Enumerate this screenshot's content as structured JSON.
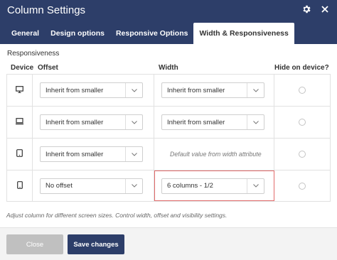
{
  "window": {
    "title": "Column Settings"
  },
  "tabs": [
    {
      "label": "General",
      "active": false
    },
    {
      "label": "Design options",
      "active": false
    },
    {
      "label": "Responsive Options",
      "active": false
    },
    {
      "label": "Width & Responsiveness",
      "active": true
    }
  ],
  "section": {
    "title": "Responsiveness"
  },
  "table": {
    "headers": {
      "device": "Device",
      "offset": "Offset",
      "width": "Width",
      "hide": "Hide on device?"
    },
    "rows": [
      {
        "device_icon": "desktop-icon",
        "offset": "Inherit from smaller",
        "width": "Inherit from smaller",
        "width_note": "",
        "hide": false
      },
      {
        "device_icon": "laptop-icon",
        "offset": "Inherit from smaller",
        "width": "Inherit from smaller",
        "width_note": "",
        "hide": false
      },
      {
        "device_icon": "tablet-icon",
        "offset": "Inherit from smaller",
        "width": "",
        "width_note": "Default value from width attribute",
        "hide": false
      },
      {
        "device_icon": "phone-icon",
        "offset": "No offset",
        "width": "6 columns - 1/2",
        "width_note": "",
        "hide": false
      }
    ]
  },
  "note": "Adjust column for different screen sizes. Control width, offset and visibility settings.",
  "footer": {
    "close_label": "Close",
    "save_label": "Save changes"
  },
  "colors": {
    "header_bg": "#2d3e69",
    "highlight_border": "#e26b6b"
  }
}
